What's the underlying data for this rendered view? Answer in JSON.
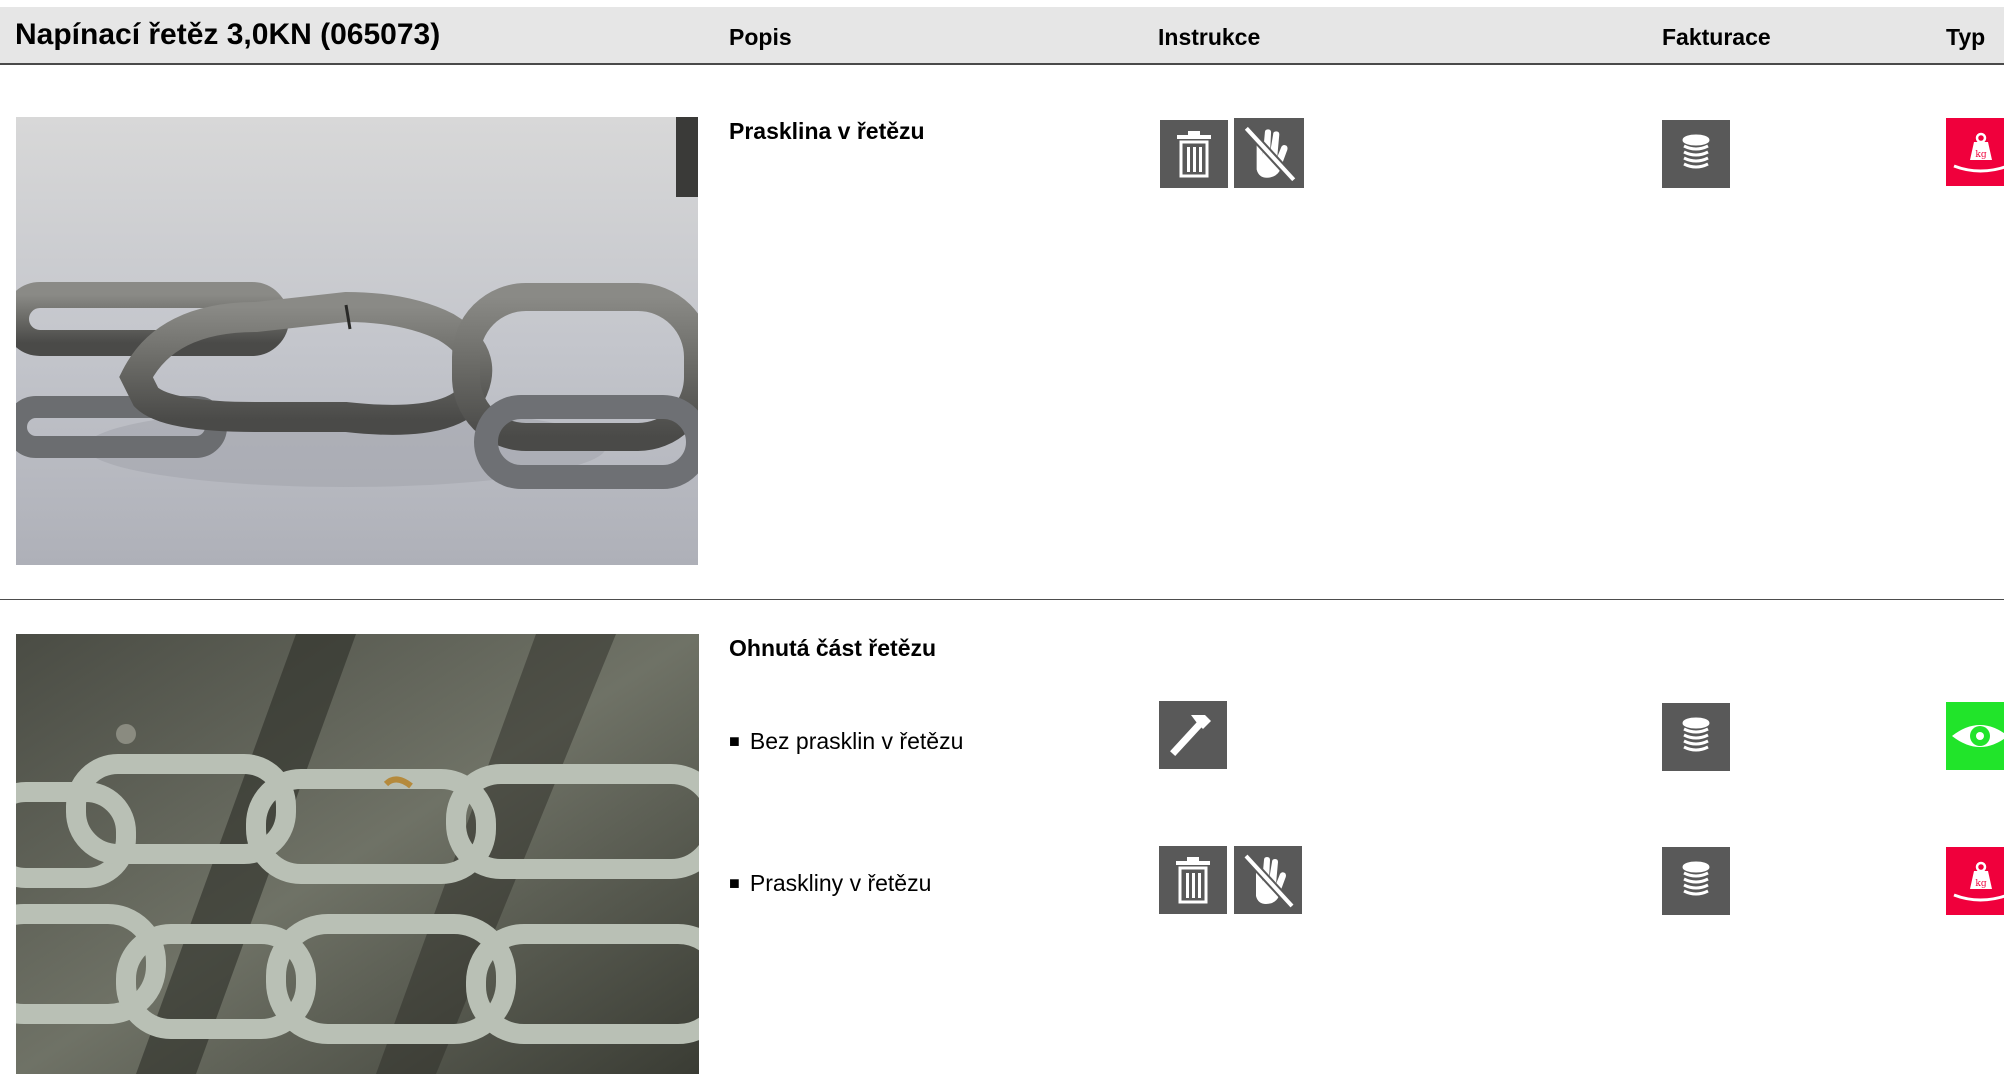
{
  "header": {
    "title": "Napínací řetěz 3,0KN (065073)",
    "columns": {
      "popis": "Popis",
      "instrukce": "Instrukce",
      "fakturace": "Fakturace",
      "typ": "Typ"
    }
  },
  "sections": [
    {
      "title": "Prasklina v řetězu",
      "photo_icon": "cracked-chain-photo",
      "rows": [
        {
          "label": "",
          "instructions": [
            "trash-icon",
            "no-touch-icon"
          ],
          "billing": "coins-icon",
          "type": "weight-icon",
          "type_color": "#f0003c"
        }
      ]
    },
    {
      "title": "Ohnutá část řetězu",
      "photo_icon": "bent-chain-photo",
      "rows": [
        {
          "label": "Bez prasklin v řetězu",
          "instructions": [
            "hammer-icon"
          ],
          "billing": "coins-icon",
          "type": "eye-icon",
          "type_color": "#21e42a"
        },
        {
          "label": "Praskliny v řetězu",
          "instructions": [
            "trash-icon",
            "no-touch-icon"
          ],
          "billing": "coins-icon",
          "type": "weight-icon",
          "type_color": "#f0003c"
        }
      ]
    }
  ],
  "bullet_marker": "■",
  "weight_label": "kg"
}
